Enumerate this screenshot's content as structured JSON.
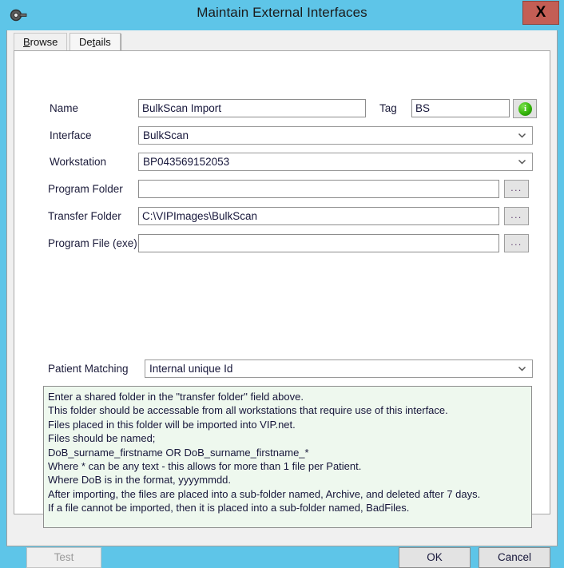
{
  "window": {
    "title": "Maintain External Interfaces",
    "app_icon": "wrench-icon",
    "close_label": "X"
  },
  "tabs": [
    {
      "label": "Browse",
      "mnemonic": "B",
      "active": false,
      "name": "tab-browse"
    },
    {
      "label": "Details",
      "mnemonic": "t",
      "active": true,
      "name": "tab-details"
    }
  ],
  "form": {
    "name": {
      "label": "Name",
      "value": "BulkScan Import",
      "placeholder": ""
    },
    "tag": {
      "label": "Tag",
      "value": "BS",
      "placeholder": "",
      "info_icon": "info-circle-icon",
      "info_glyph": "i"
    },
    "interface": {
      "label": "Interface",
      "value": "BulkScan",
      "options": [
        "BulkScan"
      ]
    },
    "workstation": {
      "label": "Workstation",
      "value": "BP043569152053",
      "options": [
        "BP043569152053"
      ]
    },
    "program_folder": {
      "label": "Program Folder",
      "value": "",
      "placeholder": "",
      "browse_label": "..."
    },
    "transfer_folder": {
      "label": "Transfer Folder",
      "value": "C:\\VIPImages\\BulkScan",
      "placeholder": "",
      "browse_label": "..."
    },
    "program_file": {
      "label": "Program File (exe)",
      "value": "",
      "placeholder": "",
      "browse_label": "..."
    },
    "patient_matching": {
      "label": "Patient Matching",
      "value": "Internal unique Id",
      "options": [
        "Internal unique Id"
      ]
    }
  },
  "help": {
    "lines": [
      "Enter a shared folder in the \"transfer folder\" field above.",
      "This folder should be accessable from all workstations that require use of this interface.",
      "Files placed in this folder will be imported into VIP.net.",
      "Files should be named;",
      "DoB_surname_firstname OR DoB_surname_firstname_*",
      "Where * can be any text - this allows for more than 1 file per Patient.",
      "Where DoB is in the format, yyyymmdd.",
      "After importing, the files are placed into a sub-folder named, Archive, and deleted after 7 days.",
      "If a file cannot be imported, then it is placed into a sub-folder named, BadFiles."
    ]
  },
  "buttons": {
    "test": "Test",
    "ok": "OK",
    "cancel": "Cancel"
  },
  "colors": {
    "titlebar": "#5ec5e8",
    "close_button": "#c35e55",
    "help_background": "#eef8ee",
    "info_icon_green": "#34b409"
  }
}
